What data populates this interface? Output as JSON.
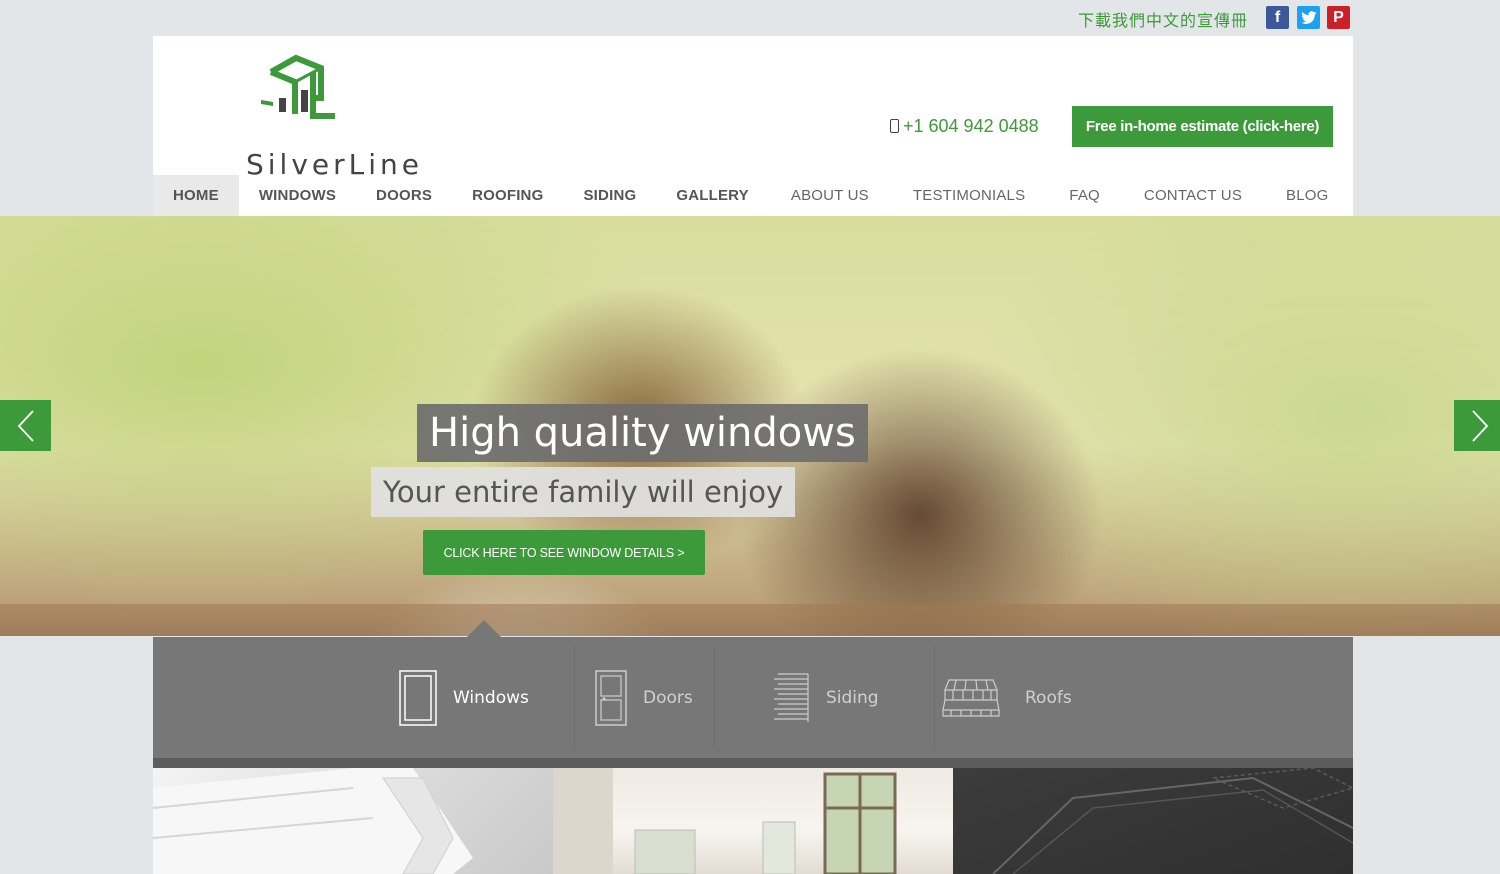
{
  "topbar": {
    "chinese_brochure": "下載我們中文的宣傳冊",
    "social": [
      {
        "name": "facebook",
        "glyph": "f"
      },
      {
        "name": "twitter",
        "glyph": "t"
      },
      {
        "name": "pinterest",
        "glyph": "P"
      }
    ]
  },
  "header": {
    "logo_text": "SilverLine",
    "phone": "+1 604 942 0488",
    "estimate_button": "Free in-home estimate (click-here)"
  },
  "nav": {
    "items": [
      "HOME",
      "WINDOWS",
      "DOORS",
      "ROOFING",
      "SIDING",
      "GALLERY",
      "ABOUT US",
      "TESTIMONIALS",
      "FAQ",
      "CONTACT US",
      "BLOG"
    ]
  },
  "hero": {
    "title": "High quality windows",
    "subtitle": "Your entire family will enjoy",
    "cta": "CLICK HERE TO SEE WINDOW DETAILS >"
  },
  "product_tabs": {
    "items": [
      "Windows",
      "Doors",
      "Siding",
      "Roofs"
    ]
  },
  "colors": {
    "brand_green": "#3d9a3a",
    "tab_gray": "#777777"
  },
  "icons": {
    "prev": "chevron-left-icon",
    "next": "chevron-right-icon",
    "phone": "phone-icon"
  }
}
